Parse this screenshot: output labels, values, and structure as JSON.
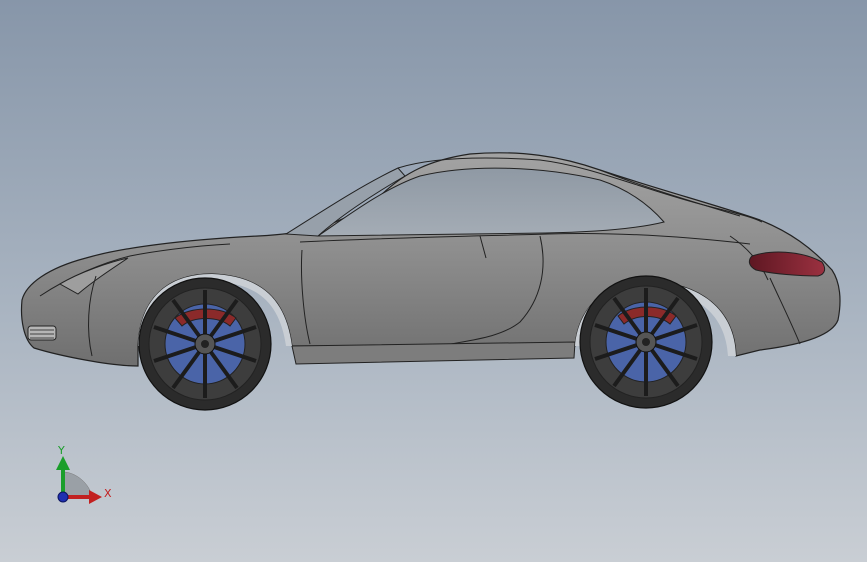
{
  "viewport": {
    "background_top": "#8796a9",
    "background_bottom": "#c9ced4"
  },
  "model": {
    "body_color": "#8d8d8d",
    "glass_color": "#9aa3ad",
    "taillight_color": "#7a2130",
    "tire_color": "#2b2b2b",
    "rim_color": "#4a4a4a",
    "brake_disc_color": "#4a64a8",
    "caliper_color": "#8b2a2a"
  },
  "triad": {
    "y_label": "Y",
    "x_label": "X",
    "y_color": "#1a9e2a",
    "x_color": "#c22020",
    "z_color": "#1f2fb0"
  }
}
